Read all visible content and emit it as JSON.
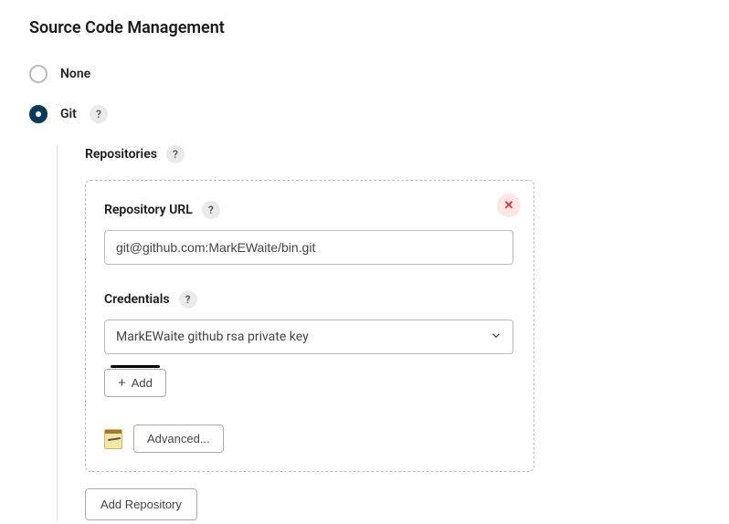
{
  "section_title": "Source Code Management",
  "scm_options": {
    "none_label": "None",
    "git_label": "Git"
  },
  "repositories_label": "Repositories",
  "repo": {
    "url_label": "Repository URL",
    "url_value": "git@github.com:MarkEWaite/bin.git",
    "credentials_label": "Credentials",
    "credentials_selected": "MarkEWaite github rsa private key",
    "add_label": "Add",
    "advanced_label": "Advanced..."
  },
  "add_repository_label": "Add Repository",
  "help_char": "?",
  "close_char": "✕",
  "plus_char": "+"
}
